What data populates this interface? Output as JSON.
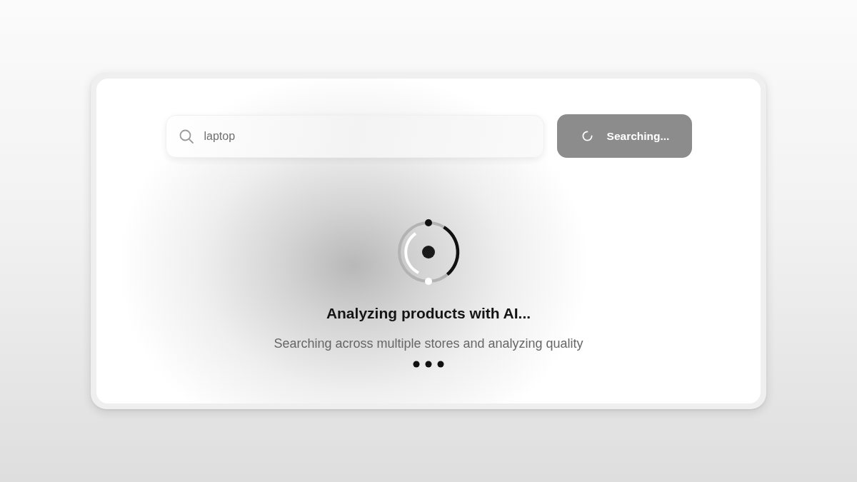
{
  "search": {
    "value": "laptop"
  },
  "search_button": {
    "label": "Searching...",
    "loading": true
  },
  "status": {
    "title": "Analyzing products with AI...",
    "subtitle": "Searching across multiple stores and analyzing quality"
  }
}
